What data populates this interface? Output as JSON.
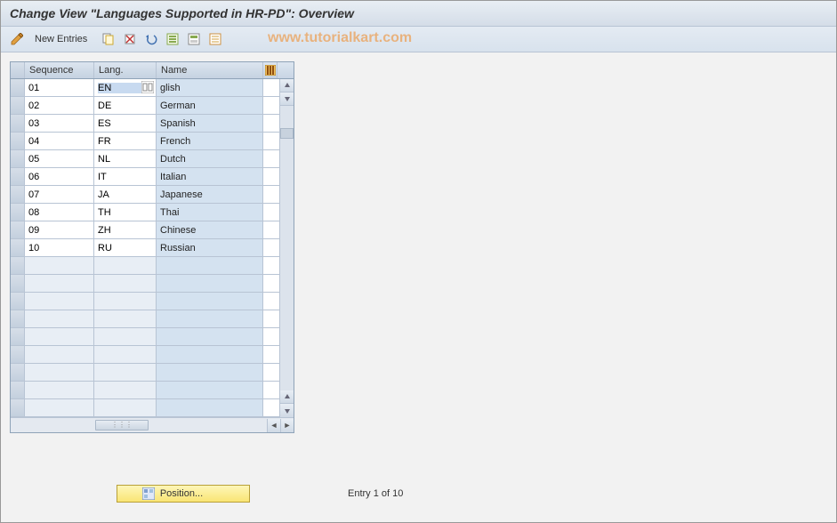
{
  "title": "Change View \"Languages Supported in HR-PD\": Overview",
  "toolbar": {
    "new_entries_label": "New Entries"
  },
  "watermark": "www.tutorialkart.com",
  "columns": {
    "sequence": "Sequence",
    "lang": "Lang.",
    "name": "Name"
  },
  "rows": [
    {
      "seq": "01",
      "lang": "EN",
      "name_suffix": "glish"
    },
    {
      "seq": "02",
      "lang": "DE",
      "name_suffix": "German"
    },
    {
      "seq": "03",
      "lang": "ES",
      "name_suffix": "Spanish"
    },
    {
      "seq": "04",
      "lang": "FR",
      "name_suffix": "French"
    },
    {
      "seq": "05",
      "lang": "NL",
      "name_suffix": "Dutch"
    },
    {
      "seq": "06",
      "lang": "IT",
      "name_suffix": "Italian"
    },
    {
      "seq": "07",
      "lang": "JA",
      "name_suffix": "Japanese"
    },
    {
      "seq": "08",
      "lang": "TH",
      "name_suffix": "Thai"
    },
    {
      "seq": "09",
      "lang": "ZH",
      "name_suffix": "Chinese"
    },
    {
      "seq": "10",
      "lang": "RU",
      "name_suffix": "Russian"
    }
  ],
  "empty_rows": 9,
  "footer": {
    "position_label": "Position...",
    "entry_info": "Entry 1 of 10"
  }
}
